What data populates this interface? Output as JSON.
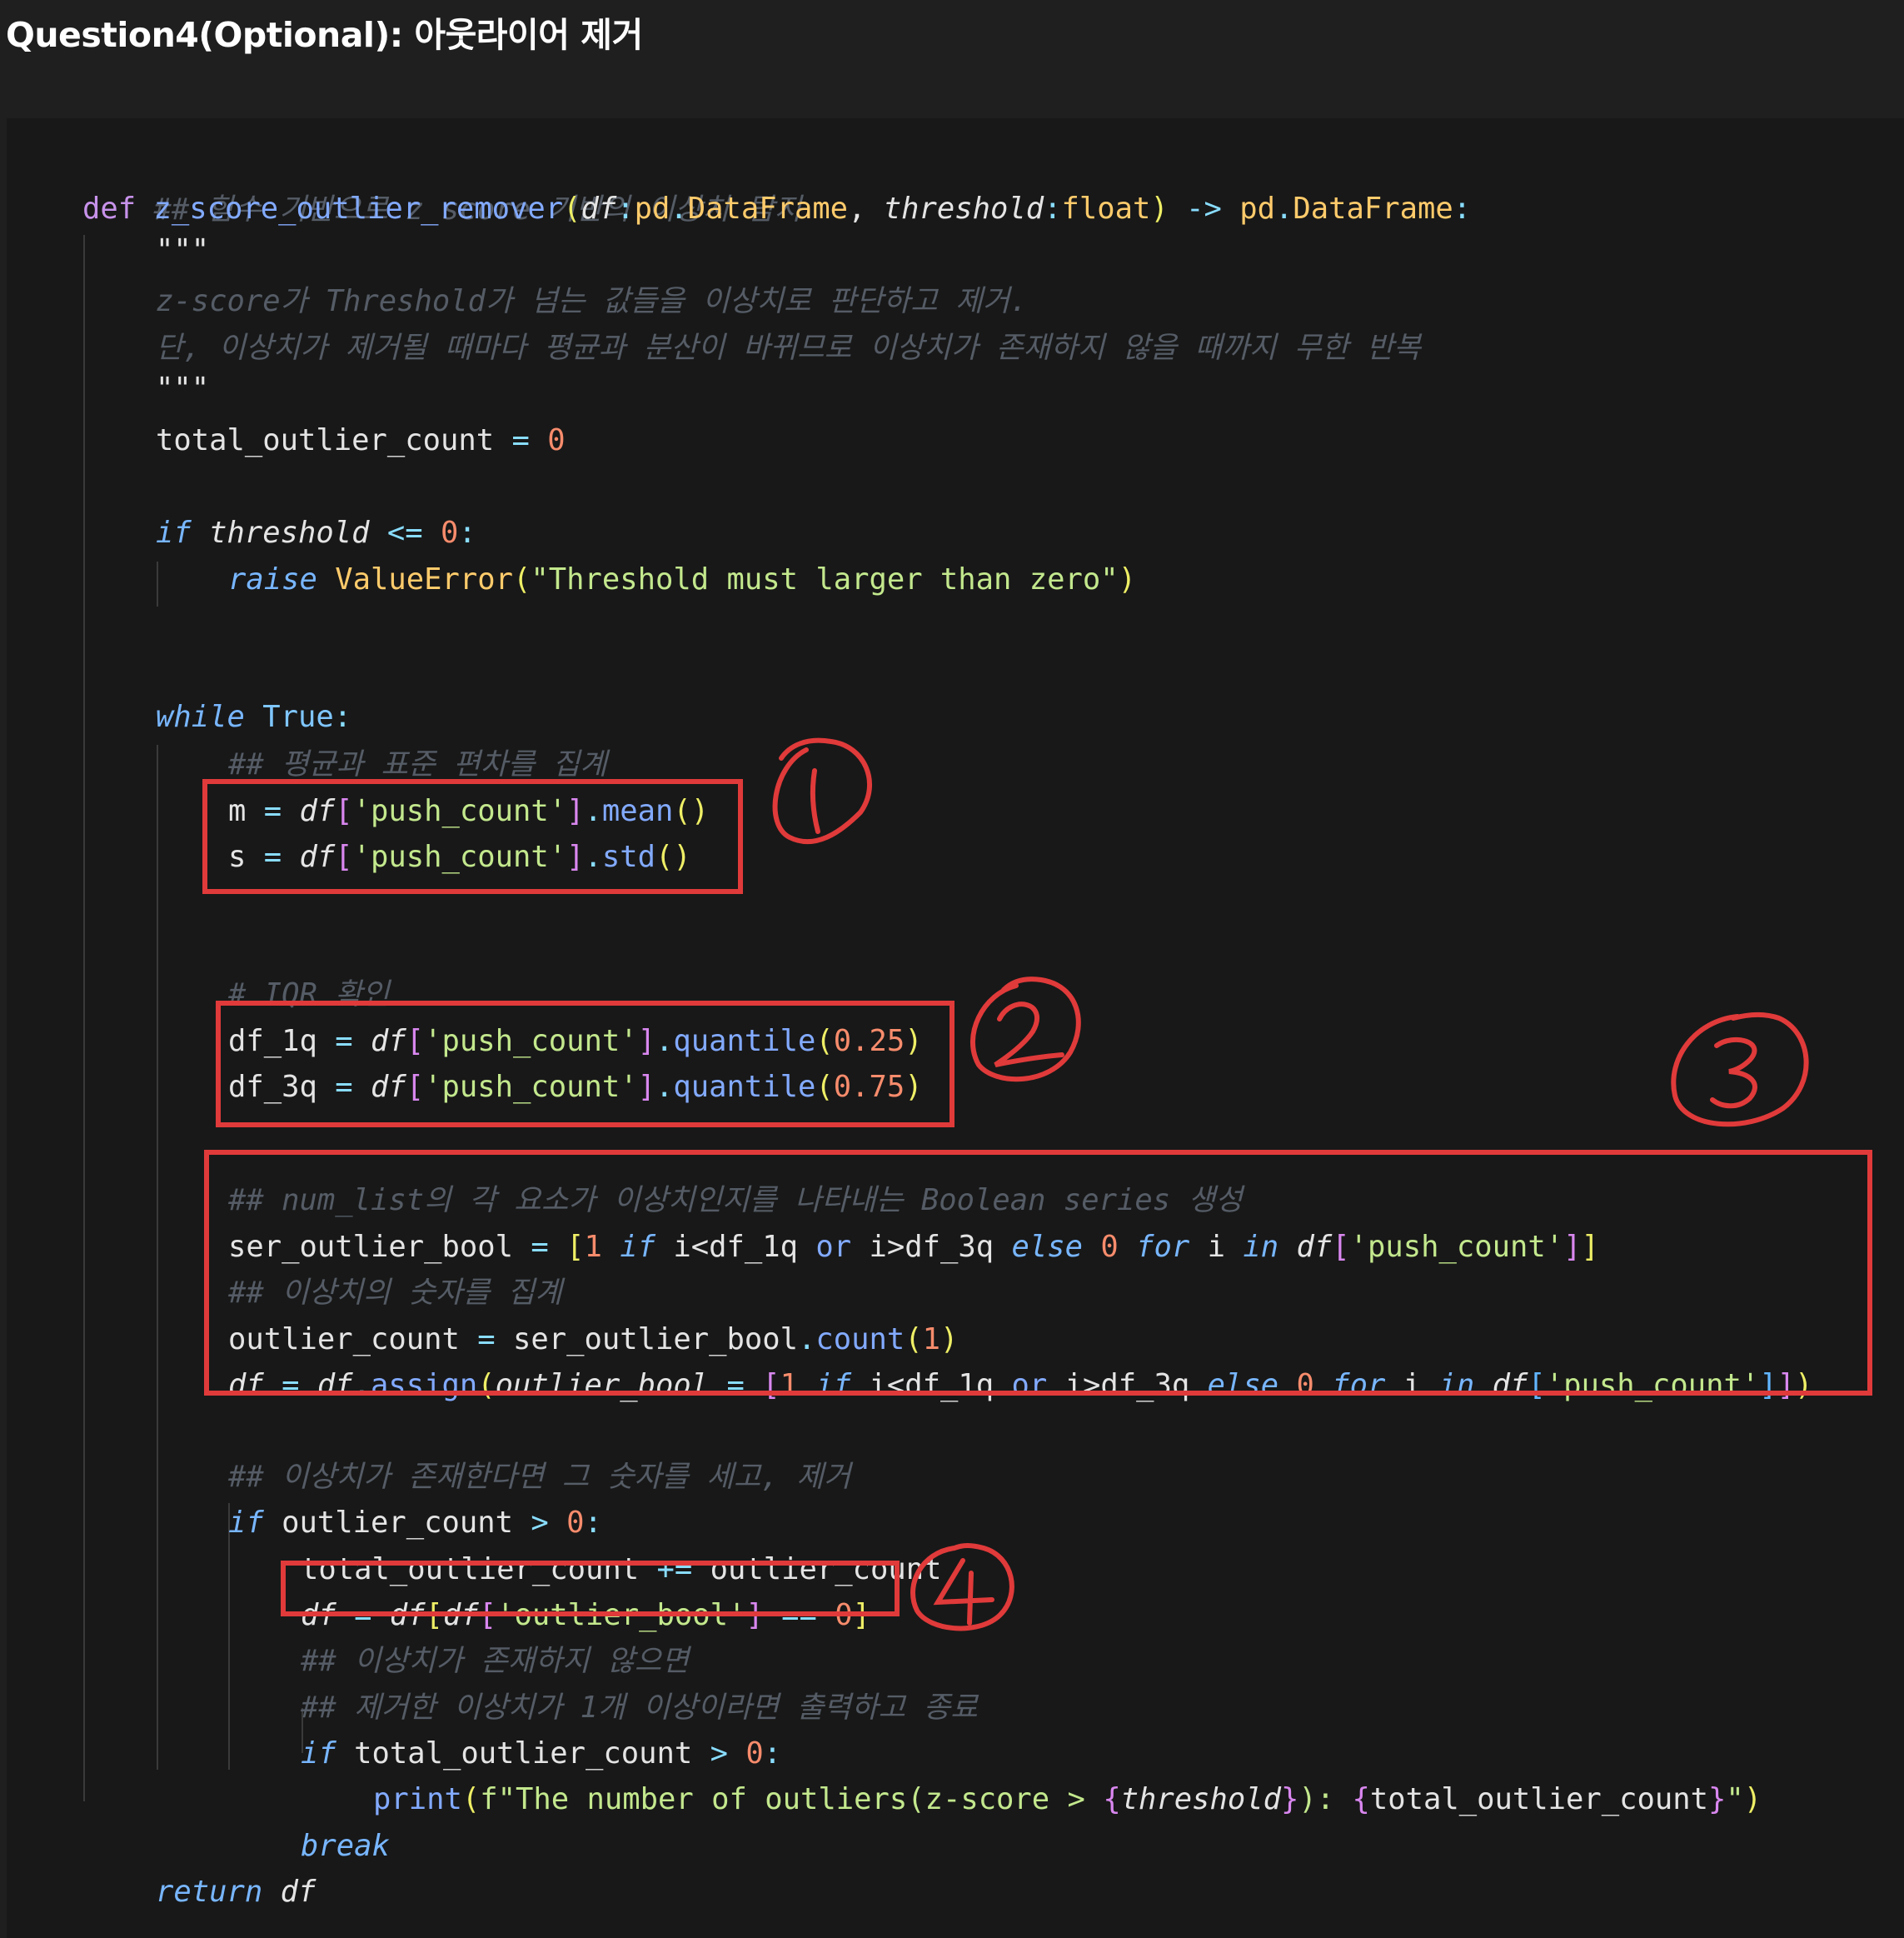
{
  "header": {
    "title": "Question4(Optional): 아웃라이어 제거"
  },
  "code": {
    "c_title": "## 함수 기반으로 z score 기반의 이상치 탐지",
    "l_def": {
      "kw": "def",
      "name": "z_score_outlier_remover",
      "p1": "df",
      "t1": "pd",
      "t1b": "DataFrame",
      "p2": "threshold",
      "t2": "float",
      "arrow": "->",
      "rt": "pd",
      "rt2": "DataFrame"
    },
    "doc_open": "\"\"\"",
    "doc_1": "z-score가 Threshold가 넘는 값들을 이상치로 판단하고 제거.",
    "doc_2": "단, 이상치가 제거될 때마다 평균과 분산이 바뀌므로 이상치가 존재하지 않을 때까지 무한 반복",
    "doc_close": "\"\"\"",
    "l_total": {
      "var": "total_outlier_count",
      "eq": "=",
      "val": "0"
    },
    "l_if1": {
      "kw": "if",
      "var": "threshold",
      "op": "<=",
      "val": "0"
    },
    "l_raise": {
      "kw": "raise",
      "cls": "ValueError",
      "msg": "\"Threshold must larger than zero\""
    },
    "l_while": {
      "kw": "while",
      "val": "True"
    },
    "c_mean": "## 평균과 표준 편차를 집계",
    "l_m": {
      "var": "m",
      "df": "df",
      "key": "'push_count'",
      "fn": "mean"
    },
    "l_s": {
      "var": "s",
      "df": "df",
      "key": "'push_count'",
      "fn": "std"
    },
    "c_iqr": "# IQR 확인",
    "l_q1": {
      "var": "df_1q",
      "df": "df",
      "key": "'push_count'",
      "fn": "quantile",
      "arg": "0.25"
    },
    "l_q3": {
      "var": "df_3q",
      "df": "df",
      "key": "'push_count'",
      "fn": "quantile",
      "arg": "0.75"
    },
    "c_bool": "## num_list의 각 요소가 이상치인지를 나타내는 Boolean series 생성",
    "l_ser": {
      "var": "ser_outlier_bool",
      "one": "1",
      "if": "if",
      "c1": "i<df_1q",
      "or": "or",
      "c2": "i>df_3q",
      "else": "else",
      "zero": "0",
      "for": "for",
      "i": "i",
      "in": "in",
      "df": "df",
      "key": "'push_count'"
    },
    "c_count": "## 이상치의 숫자를 집계",
    "l_cnt": {
      "var": "outlier_count",
      "obj": "ser_outlier_bool",
      "fn": "count",
      "arg": "1"
    },
    "l_assign": {
      "var": "df",
      "obj": "df",
      "fn": "assign",
      "kw": "outlier_bool",
      "one": "1",
      "if": "if",
      "c1": "i<df_1q",
      "or": "or",
      "c2": "i>df_3q",
      "else": "else",
      "zero": "0",
      "for": "for",
      "i": "i",
      "in": "in",
      "df": "df",
      "key": "'push_count'"
    },
    "c_exist": "## 이상치가 존재한다면 그 숫자를 세고, 제거",
    "l_if2": {
      "kw": "if",
      "var": "outlier_count",
      "op": ">",
      "val": "0"
    },
    "l_add": {
      "var": "total_outlier_count",
      "op": "+=",
      "rhs": "outlier_count"
    },
    "l_filter": {
      "var": "df",
      "df": "df",
      "df2": "df",
      "key": "'outlier_bool'",
      "op": "==",
      "val": "0"
    },
    "c_none": "## 이상치가 존재하지 않으면",
    "c_print": "## 제거한 이상치가 1개 이상이라면 출력하고 종료",
    "l_if3": {
      "kw": "if",
      "var": "total_outlier_count",
      "op": ">",
      "val": "0"
    },
    "l_print": {
      "fn": "print",
      "pre": "f\"The number of outliers(z-score > ",
      "v1": "threshold",
      "mid": "): ",
      "v2": "total_outlier_count",
      "end": "\""
    },
    "l_break": "break",
    "l_return": {
      "kw": "return",
      "var": "df"
    }
  },
  "annotations": {
    "marks": [
      "1",
      "2",
      "3",
      "4"
    ],
    "color": "#e03a3a"
  }
}
